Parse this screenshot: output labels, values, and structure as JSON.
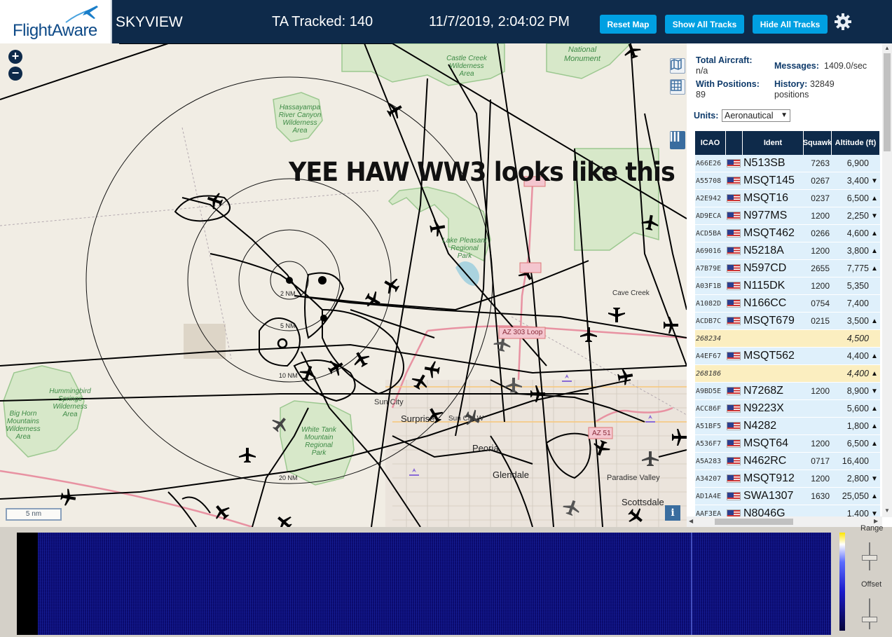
{
  "header": {
    "logo_text": "FlightAware",
    "app_name": "SKYVIEW",
    "ta_tracked_label": "TA Tracked: 140",
    "datetime": "11/7/2019, 2:04:02 PM",
    "buttons": {
      "reset_map": "Reset Map",
      "show_all_tracks": "Show All Tracks",
      "hide_all_tracks": "Hide All Tracks"
    },
    "settings_icon": "gear-icon",
    "colors": {
      "bar": "#0e2a4a",
      "button": "#00a0e2"
    }
  },
  "map": {
    "caption": "YEE HAW WW3 looks like this",
    "zoom_in": "+",
    "zoom_out": "−",
    "scale": "5 nm",
    "info_button": "i",
    "range_rings": [
      "2 NM",
      "5 NM",
      "10 NM",
      "20 NM"
    ],
    "labels": {
      "castle_creek": [
        "Castle Creek",
        "Wilderness",
        "Area"
      ],
      "national_monument": [
        "National",
        "Monument"
      ],
      "hassayampa": [
        "Hassayampa",
        "River Canyon",
        "Wilderness",
        "Area"
      ],
      "lake_pleasant": [
        "Lake Pleasant",
        "Regional",
        "Park"
      ],
      "cave_creek": "Cave Creek",
      "az303": "AZ 303 Loop",
      "hummingbird": [
        "Hummingbird",
        "Springs",
        "Wilderness",
        "Area"
      ],
      "big_horn": [
        "Big Horn",
        "Mountains",
        "Wilderness",
        "Area"
      ],
      "white_tank": [
        "White Tank",
        "Mountain",
        "Regional",
        "Park"
      ],
      "sun_city": "Sun City",
      "sun_city_west": "Sun City W",
      "surprise": "Surprise",
      "peoria": "Peoria",
      "glendale": "Glendale",
      "paradise_valley": "Paradise Valley",
      "scottsdale": "Scottsdale",
      "az51": "AZ 51"
    }
  },
  "stats": {
    "total_aircraft_label": "Total Aircraft:",
    "total_aircraft_value": "n/a",
    "with_positions_label": "With Positions:",
    "with_positions_value": "89",
    "messages_label": "Messages:",
    "messages_value": "1409.0/sec",
    "history_label": "History:",
    "history_value": "32849",
    "history_unit": "positions",
    "units_label": "Units:",
    "units_value": "Aeronautical"
  },
  "table": {
    "columns": [
      "ICAO",
      "",
      "Ident",
      "Squawk",
      "Altitude (ft)"
    ],
    "rows": [
      {
        "icao": "A66E26",
        "flag": true,
        "ident": "N513SB",
        "squawk": "7263",
        "alt": "6,900",
        "trend": "",
        "highlight": false
      },
      {
        "icao": "A55708",
        "flag": true,
        "ident": "MSQT145",
        "squawk": "0267",
        "alt": "3,400",
        "trend": "▼",
        "highlight": false
      },
      {
        "icao": "A2E942",
        "flag": true,
        "ident": "MSQT16",
        "squawk": "0237",
        "alt": "6,500",
        "trend": "▲",
        "highlight": false
      },
      {
        "icao": "AD9ECA",
        "flag": true,
        "ident": "N977MS",
        "squawk": "1200",
        "alt": "2,250",
        "trend": "▼",
        "highlight": false
      },
      {
        "icao": "ACD5BA",
        "flag": true,
        "ident": "MSQT462",
        "squawk": "0266",
        "alt": "4,600",
        "trend": "▲",
        "highlight": false
      },
      {
        "icao": "A69016",
        "flag": true,
        "ident": "N5218A",
        "squawk": "1200",
        "alt": "3,800",
        "trend": "▲",
        "highlight": false
      },
      {
        "icao": "A7B79E",
        "flag": true,
        "ident": "N597CD",
        "squawk": "2655",
        "alt": "7,775",
        "trend": "▲",
        "highlight": false
      },
      {
        "icao": "A03F1B",
        "flag": true,
        "ident": "N115DK",
        "squawk": "1200",
        "alt": "5,350",
        "trend": "",
        "highlight": false
      },
      {
        "icao": "A1082D",
        "flag": true,
        "ident": "N166CC",
        "squawk": "0754",
        "alt": "7,400",
        "trend": "",
        "highlight": false
      },
      {
        "icao": "ACDB7C",
        "flag": true,
        "ident": "MSQT679",
        "squawk": "0215",
        "alt": "3,500",
        "trend": "▲",
        "highlight": false
      },
      {
        "icao": "268234",
        "flag": false,
        "ident": "",
        "squawk": "",
        "alt": "4,500",
        "trend": "",
        "highlight": true
      },
      {
        "icao": "A4EF67",
        "flag": true,
        "ident": "MSQT562",
        "squawk": "",
        "alt": "4,400",
        "trend": "▲",
        "highlight": false
      },
      {
        "icao": "268186",
        "flag": false,
        "ident": "",
        "squawk": "",
        "alt": "4,400",
        "trend": "▲",
        "highlight": true
      },
      {
        "icao": "A9BD5E",
        "flag": true,
        "ident": "N7268Z",
        "squawk": "1200",
        "alt": "8,900",
        "trend": "▼",
        "highlight": false
      },
      {
        "icao": "ACC86F",
        "flag": true,
        "ident": "N9223X",
        "squawk": "",
        "alt": "5,600",
        "trend": "▲",
        "highlight": false
      },
      {
        "icao": "A51BF5",
        "flag": true,
        "ident": "N4282",
        "squawk": "",
        "alt": "1,800",
        "trend": "▲",
        "highlight": false
      },
      {
        "icao": "A536F7",
        "flag": true,
        "ident": "MSQT64",
        "squawk": "1200",
        "alt": "6,500",
        "trend": "▲",
        "highlight": false
      },
      {
        "icao": "A5A283",
        "flag": true,
        "ident": "N462RC",
        "squawk": "0717",
        "alt": "16,400",
        "trend": "",
        "highlight": false
      },
      {
        "icao": "A34207",
        "flag": true,
        "ident": "MSQT912",
        "squawk": "1200",
        "alt": "2,800",
        "trend": "▼",
        "highlight": false
      },
      {
        "icao": "AD1A4E",
        "flag": true,
        "ident": "SWA1307",
        "squawk": "1630",
        "alt": "25,050",
        "trend": "▲",
        "highlight": false
      },
      {
        "icao": "AAF3EA",
        "flag": true,
        "ident": "N8046G",
        "squawk": "",
        "alt": "1,400",
        "trend": "▼",
        "highlight": false
      }
    ]
  },
  "waterfall": {
    "range_label": "Range",
    "offset_label": "Offset"
  }
}
